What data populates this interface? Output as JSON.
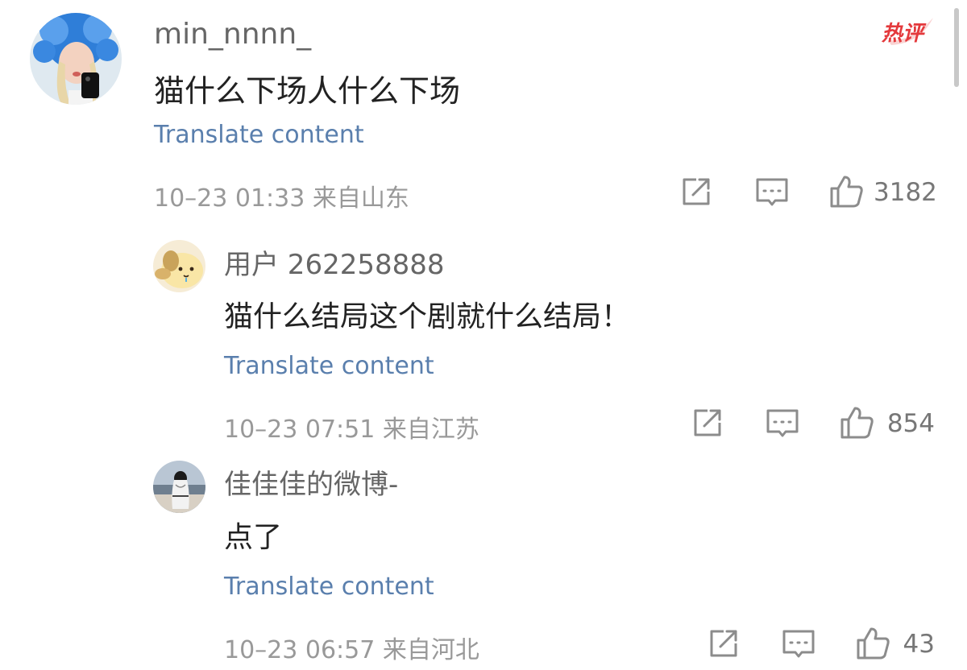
{
  "badge": {
    "label": "热评",
    "color": "#e4393c"
  },
  "colors": {
    "link": "#5a7fad",
    "meta": "#999999",
    "icon": "#8c8c8c"
  },
  "comments": [
    {
      "username": "min_nnnn_",
      "content": "猫什么下场人什么下场",
      "translate_label": "Translate content",
      "meta": "10–23 01:33 来自山东",
      "likes": "3182",
      "avatar_icon": "user-avatar-blue-fur-hat"
    },
    {
      "username": "用户 262258888",
      "content": "猫什么结局这个剧就什么结局！",
      "translate_label": "Translate content",
      "meta": "10–23 07:51 来自江苏",
      "likes": "854",
      "avatar_icon": "user-avatar-pompompurin"
    },
    {
      "username": "佳佳佳的微博-",
      "content": "点了",
      "translate_label": "Translate content",
      "meta": "10–23 06:57 来自河北",
      "likes": "43",
      "avatar_icon": "user-avatar-seaside-photo"
    }
  ]
}
